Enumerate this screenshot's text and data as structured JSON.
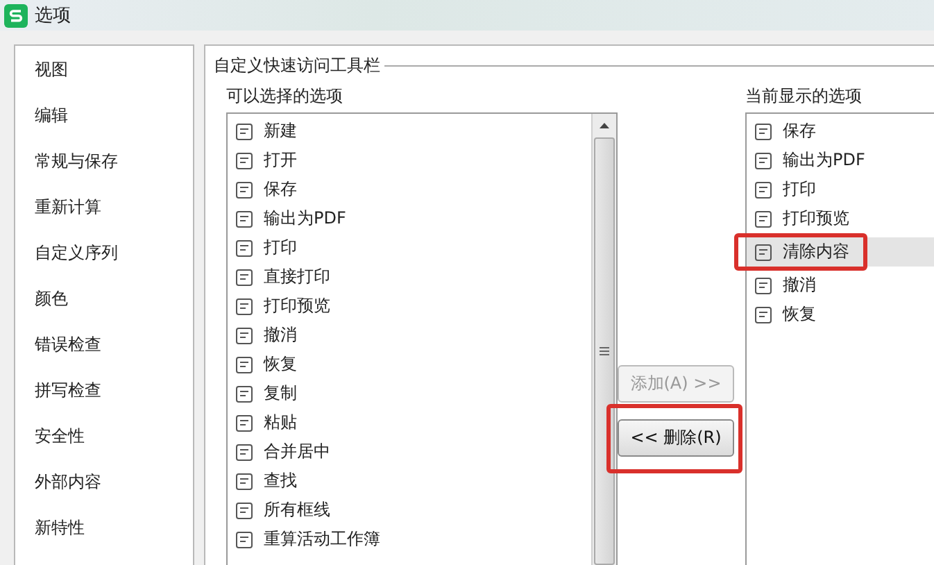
{
  "window": {
    "title": "选项"
  },
  "sidebar": {
    "items": [
      {
        "label": "视图"
      },
      {
        "label": "编辑"
      },
      {
        "label": "常规与保存"
      },
      {
        "label": "重新计算"
      },
      {
        "label": "自定义序列"
      },
      {
        "label": "颜色"
      },
      {
        "label": "错误检查"
      },
      {
        "label": "拼写检查"
      },
      {
        "label": "安全性"
      },
      {
        "label": "外部内容"
      },
      {
        "label": "新特性"
      }
    ]
  },
  "group_title": "自定义快速访问工具栏",
  "available": {
    "label": "可以选择的选项",
    "items": [
      {
        "label": "新建"
      },
      {
        "label": "打开"
      },
      {
        "label": "保存"
      },
      {
        "label": "输出为PDF"
      },
      {
        "label": "打印"
      },
      {
        "label": "直接打印"
      },
      {
        "label": "打印预览"
      },
      {
        "label": "撤消"
      },
      {
        "label": "恢复"
      },
      {
        "label": "复制"
      },
      {
        "label": "粘贴"
      },
      {
        "label": "合并居中"
      },
      {
        "label": "查找"
      },
      {
        "label": "所有框线"
      },
      {
        "label": "重算活动工作簿"
      }
    ]
  },
  "buttons": [
    {
      "label": "添加(A) >>",
      "disabled": true,
      "highlighted": false
    },
    {
      "label": "<< 删除(R)",
      "disabled": false,
      "highlighted": true
    }
  ],
  "current": {
    "label": "当前显示的选项",
    "items": [
      {
        "label": "保存",
        "selected": false,
        "highlighted": false
      },
      {
        "label": "输出为PDF",
        "selected": false,
        "highlighted": false
      },
      {
        "label": "打印",
        "selected": false,
        "highlighted": false
      },
      {
        "label": "打印预览",
        "selected": false,
        "highlighted": false
      },
      {
        "label": "清除内容",
        "selected": true,
        "highlighted": true
      },
      {
        "label": "撤消",
        "selected": false,
        "highlighted": false
      },
      {
        "label": "恢复",
        "selected": false,
        "highlighted": false
      }
    ]
  }
}
